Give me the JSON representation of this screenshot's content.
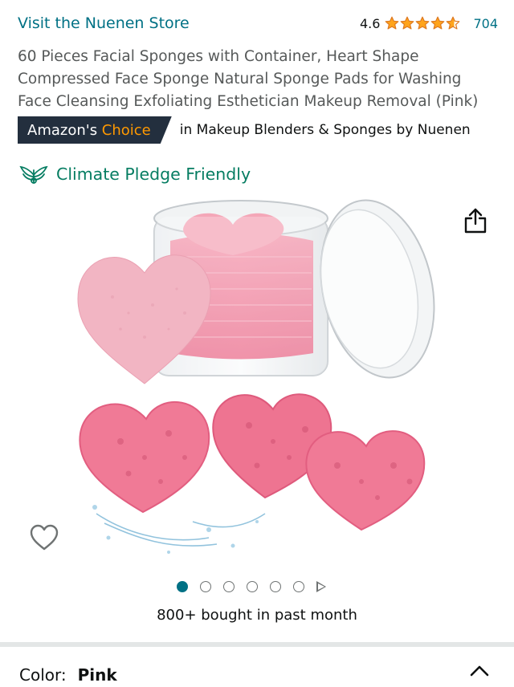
{
  "header": {
    "store_link": "Visit the Nuenen Store",
    "rating": "4.6",
    "stars": 4.6,
    "review_count": "704"
  },
  "product": {
    "title": "60 Pieces Facial Sponges with Container, Heart Shape Compressed Face Sponge Natural Sponge Pads for Washing Face Cleansing Exfoliating Esthetician Makeup Removal (Pink)"
  },
  "badge": {
    "prefix": "Amazon's ",
    "highlight": "Choice",
    "context": "in Makeup Blenders & Sponges by Nuenen"
  },
  "climate": {
    "label": "Climate Pledge Friendly"
  },
  "gallery": {
    "image_count": 6,
    "active_index": 0
  },
  "social_proof": {
    "bought": "800+ bought in past month"
  },
  "variant": {
    "color_label": "Color:",
    "color_value": "Pink"
  },
  "colors": {
    "link": "#007185",
    "star": "#ffa41c",
    "badge_bg": "#232f3e",
    "badge_accent": "#ff9900",
    "climate": "#067d62"
  },
  "icons": {
    "share": "share-icon",
    "wishlist": "heart-icon",
    "collapse": "chevron-up-icon",
    "climate": "climate-pledge-icon"
  }
}
